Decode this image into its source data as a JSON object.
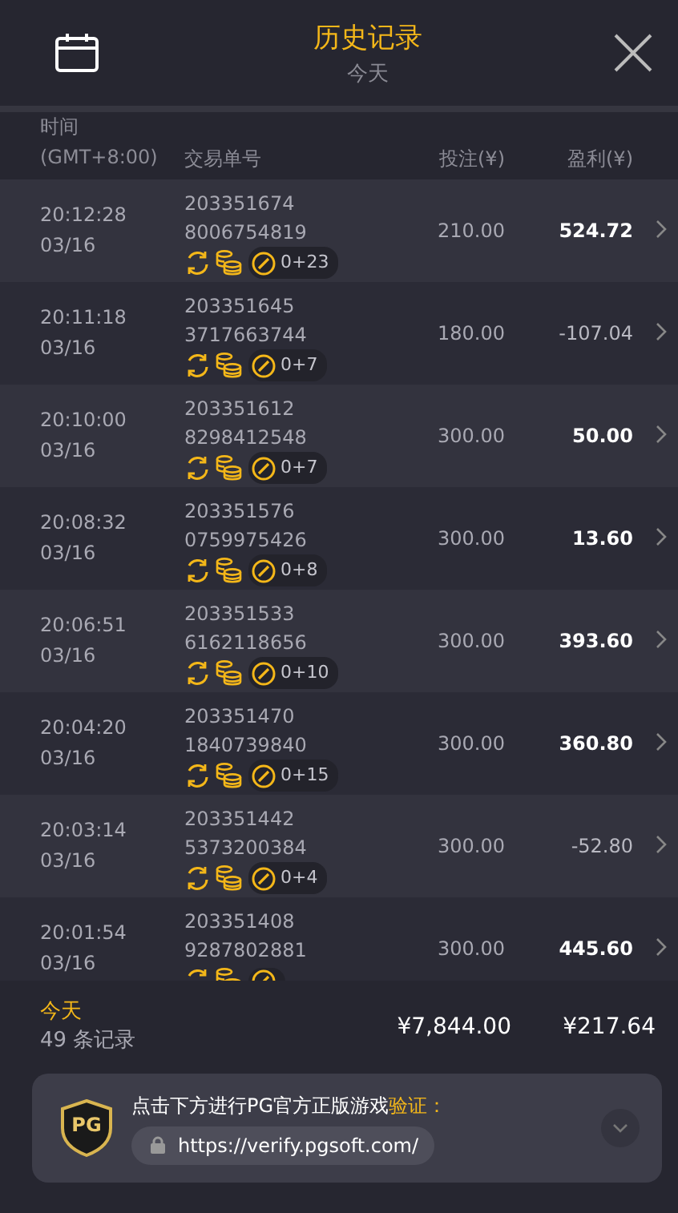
{
  "header": {
    "title": "历史记录",
    "subtitle": "今天"
  },
  "columns": [
    {
      "label": "时间\n(GMT+8:00)"
    },
    {
      "label": "交易单号"
    },
    {
      "label": "投注(¥)"
    },
    {
      "label": "盈利(¥)"
    }
  ],
  "rows": [
    {
      "time": "20:12:28",
      "date": "03/16",
      "id1": "203351674",
      "id2": "8006754819",
      "badge": "0+23",
      "bet": "210.00",
      "profit": "524.72",
      "bold": true
    },
    {
      "time": "20:11:18",
      "date": "03/16",
      "id1": "203351645",
      "id2": "3717663744",
      "badge": "0+7",
      "bet": "180.00",
      "profit": "-107.04",
      "bold": false
    },
    {
      "time": "20:10:00",
      "date": "03/16",
      "id1": "203351612",
      "id2": "8298412548",
      "badge": "0+7",
      "bet": "300.00",
      "profit": "50.00",
      "bold": true
    },
    {
      "time": "20:08:32",
      "date": "03/16",
      "id1": "203351576",
      "id2": "0759975426",
      "badge": "0+8",
      "bet": "300.00",
      "profit": "13.60",
      "bold": true
    },
    {
      "time": "20:06:51",
      "date": "03/16",
      "id1": "203351533",
      "id2": "6162118656",
      "badge": "0+10",
      "bet": "300.00",
      "profit": "393.60",
      "bold": true
    },
    {
      "time": "20:04:20",
      "date": "03/16",
      "id1": "203351470",
      "id2": "1840739840",
      "badge": "0+15",
      "bet": "300.00",
      "profit": "360.80",
      "bold": true
    },
    {
      "time": "20:03:14",
      "date": "03/16",
      "id1": "203351442",
      "id2": "5373200384",
      "badge": "0+4",
      "bet": "300.00",
      "profit": "-52.80",
      "bold": false
    },
    {
      "time": "20:01:54",
      "date": "03/16",
      "id1": "203351408",
      "id2": "9287802881",
      "bet": "300.00",
      "profit": "445.60",
      "bold": true
    }
  ],
  "summary": {
    "period": "今天",
    "count": "49 条记录",
    "total_bet": "¥7,844.00",
    "total_profit": "¥217.64"
  },
  "verify": {
    "text": "点击下方进行PG官方正版游戏",
    "highlight": "验证：",
    "logo": "PG",
    "url": "https://verify.pgsoft.com/"
  }
}
